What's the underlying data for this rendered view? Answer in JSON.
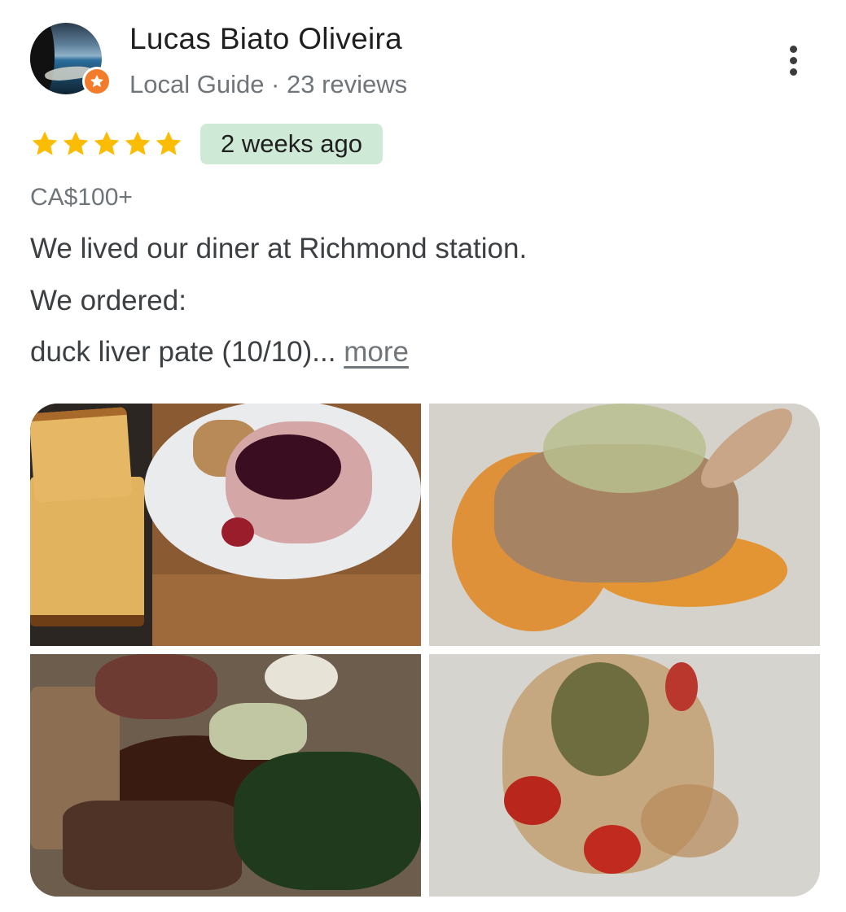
{
  "reviewer": {
    "name": "Lucas Biato Oliveira",
    "meta": "Local Guide · 23 reviews",
    "badge_icon": "local-guide-star-icon",
    "badge_color": "#f27c2c"
  },
  "review": {
    "rating": 5,
    "star_color": "#fbbc04",
    "time": "2 weeks ago",
    "time_badge_color": "#ceead6",
    "price": "CA$100+",
    "lines": [
      "We lived our diner at Richmond station.",
      "We ordered:",
      "duck liver pate (10/10)..."
    ],
    "more_label": "more"
  },
  "menu_icon": "more-vert-icon",
  "photos": [
    {
      "icon": "photo-duck-liver-pate"
    },
    {
      "icon": "photo-fried-dish"
    },
    {
      "icon": "photo-duck-plate"
    },
    {
      "icon": "photo-tomato-pasta"
    }
  ]
}
